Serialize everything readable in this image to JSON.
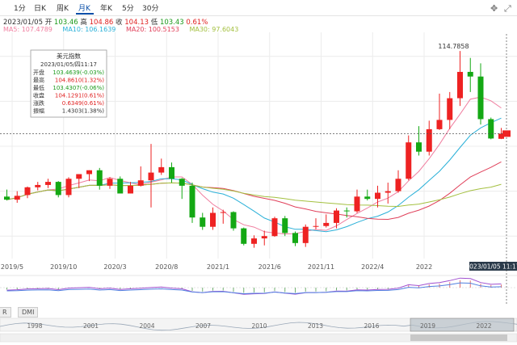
{
  "tabs": [
    {
      "label": "1分",
      "active": false
    },
    {
      "label": "日K",
      "active": false
    },
    {
      "label": "周K",
      "active": false
    },
    {
      "label": "月K",
      "active": true
    },
    {
      "label": "年K",
      "active": false
    },
    {
      "label": "5分",
      "active": false
    },
    {
      "label": "30分",
      "active": false
    }
  ],
  "icons": [
    "move-icon",
    "fullscreen-icon"
  ],
  "info": {
    "date": "2023/01/05",
    "open_label": "开",
    "open": "103.46",
    "high_label": "高",
    "high": "104.86",
    "close_label": "收",
    "close": "104.13",
    "low_label": "低",
    "low": "103.43",
    "change": "0.61%"
  },
  "ma": [
    {
      "label": "MA5: 107.4789",
      "color": "#f07fa0"
    },
    {
      "label": "MA10: 106.1639",
      "color": "#2ab0d8"
    },
    {
      "label": "MA20: 100.5153",
      "color": "#e0405a"
    },
    {
      "label": "MA30: 97.6043",
      "color": "#a4c040"
    }
  ],
  "tooltip": {
    "title": "美元指数",
    "date": "2023/01/05/四11:17",
    "rows": [
      {
        "label": "开盘",
        "value": "103.4639(-0.03%)",
        "color": "#1a9a1a"
      },
      {
        "label": "最高",
        "value": "104.8610(1.32%)",
        "color": "#e02020"
      },
      {
        "label": "最低",
        "value": "103.4307(-0.06%)",
        "color": "#1a9a1a"
      },
      {
        "label": "收盘",
        "value": "104.1291(0.61%)",
        "color": "#e02020"
      },
      {
        "label": "涨跌",
        "value": "0.6349(0.61%)",
        "color": "#e02020"
      },
      {
        "label": "振幅",
        "value": "1.4303(1.38%)",
        "color": "#333333"
      }
    ]
  },
  "peak_label": "114.7858",
  "current_time_label": "2023/01/05 11:17",
  "colors": {
    "up": "#ee2222",
    "down": "#14a814",
    "accent": "#0a4fa8"
  },
  "bottom_tabs": [
    "R",
    "DMI"
  ],
  "chart_data": {
    "type": "candlestick",
    "title": "美元指数",
    "ylim": [
      88,
      117
    ],
    "x_tick_labels": [
      "2019/5",
      "2019/10",
      "2020/3",
      "2020/8",
      "2021/1",
      "2021/6",
      "2021/11",
      "2022/4",
      "2022"
    ],
    "x_tick_index": [
      0,
      5,
      10,
      15,
      20,
      25,
      30,
      35,
      40
    ],
    "candles": [
      {
        "date": "2019/01",
        "o": 96.0,
        "h": 96.9,
        "l": 95.5,
        "c": 95.6
      },
      {
        "date": "2019/02",
        "o": 95.6,
        "h": 96.7,
        "l": 95.2,
        "c": 96.1
      },
      {
        "date": "2019/03",
        "o": 96.2,
        "h": 97.3,
        "l": 95.8,
        "c": 97.2
      },
      {
        "date": "2019/04",
        "o": 97.2,
        "h": 97.9,
        "l": 96.8,
        "c": 97.5
      },
      {
        "date": "2019/05",
        "o": 97.5,
        "h": 98.3,
        "l": 97.1,
        "c": 97.9
      },
      {
        "date": "2019/06",
        "o": 97.9,
        "h": 98.0,
        "l": 95.9,
        "c": 96.2
      },
      {
        "date": "2019/07",
        "o": 96.2,
        "h": 98.5,
        "l": 95.9,
        "c": 98.3
      },
      {
        "date": "2019/08",
        "o": 98.3,
        "h": 98.9,
        "l": 97.1,
        "c": 98.9
      },
      {
        "date": "2019/09",
        "o": 98.9,
        "h": 99.4,
        "l": 98.0,
        "c": 99.4
      },
      {
        "date": "2019/10",
        "o": 99.4,
        "h": 99.7,
        "l": 96.9,
        "c": 97.4
      },
      {
        "date": "2019/11",
        "o": 97.4,
        "h": 98.5,
        "l": 97.0,
        "c": 98.3
      },
      {
        "date": "2019/12",
        "o": 98.3,
        "h": 98.6,
        "l": 96.6,
        "c": 96.4
      },
      {
        "date": "2020/01",
        "o": 96.4,
        "h": 97.9,
        "l": 96.4,
        "c": 97.4
      },
      {
        "date": "2020/02",
        "o": 97.4,
        "h": 99.9,
        "l": 97.3,
        "c": 98.1
      },
      {
        "date": "2020/03",
        "o": 98.1,
        "h": 102.8,
        "l": 94.6,
        "c": 99.1
      },
      {
        "date": "2020/04",
        "o": 99.1,
        "h": 100.9,
        "l": 98.8,
        "c": 99.8
      },
      {
        "date": "2020/05",
        "o": 99.8,
        "h": 100.4,
        "l": 97.8,
        "c": 98.3
      },
      {
        "date": "2020/06",
        "o": 98.3,
        "h": 98.4,
        "l": 95.7,
        "c": 97.4
      },
      {
        "date": "2020/07",
        "o": 97.4,
        "h": 97.8,
        "l": 92.6,
        "c": 93.3
      },
      {
        "date": "2020/08",
        "o": 93.3,
        "h": 93.9,
        "l": 91.7,
        "c": 92.1
      },
      {
        "date": "2020/09",
        "o": 92.1,
        "h": 94.6,
        "l": 91.7,
        "c": 93.9
      },
      {
        "date": "2020/10",
        "o": 93.9,
        "h": 94.3,
        "l": 92.5,
        "c": 94.0
      },
      {
        "date": "2020/11",
        "o": 94.0,
        "h": 94.1,
        "l": 91.6,
        "c": 91.9
      },
      {
        "date": "2020/12",
        "o": 91.9,
        "h": 92.0,
        "l": 89.7,
        "c": 89.9
      },
      {
        "date": "2021/01",
        "o": 89.9,
        "h": 91.0,
        "l": 89.4,
        "c": 90.6
      },
      {
        "date": "2021/02",
        "o": 90.6,
        "h": 91.6,
        "l": 89.7,
        "c": 90.9
      },
      {
        "date": "2021/03",
        "o": 90.9,
        "h": 93.4,
        "l": 90.8,
        "c": 93.2
      },
      {
        "date": "2021/04",
        "o": 93.2,
        "h": 93.5,
        "l": 90.9,
        "c": 91.3
      },
      {
        "date": "2021/05",
        "o": 91.3,
        "h": 91.5,
        "l": 89.6,
        "c": 90.0
      },
      {
        "date": "2021/06",
        "o": 90.0,
        "h": 92.4,
        "l": 89.5,
        "c": 92.1
      },
      {
        "date": "2021/07",
        "o": 92.1,
        "h": 93.2,
        "l": 91.8,
        "c": 92.2
      },
      {
        "date": "2021/08",
        "o": 92.2,
        "h": 93.7,
        "l": 92.0,
        "c": 92.6
      },
      {
        "date": "2021/09",
        "o": 92.6,
        "h": 94.5,
        "l": 91.9,
        "c": 94.2
      },
      {
        "date": "2021/10",
        "o": 94.2,
        "h": 94.6,
        "l": 93.3,
        "c": 94.1
      },
      {
        "date": "2021/11",
        "o": 94.1,
        "h": 96.9,
        "l": 93.9,
        "c": 96.0
      },
      {
        "date": "2021/12",
        "o": 96.0,
        "h": 96.9,
        "l": 95.5,
        "c": 95.7
      },
      {
        "date": "2022/01",
        "o": 95.7,
        "h": 97.4,
        "l": 94.6,
        "c": 96.5
      },
      {
        "date": "2022/02",
        "o": 96.5,
        "h": 97.8,
        "l": 95.1,
        "c": 96.7
      },
      {
        "date": "2022/03",
        "o": 96.7,
        "h": 99.4,
        "l": 96.5,
        "c": 98.3
      },
      {
        "date": "2022/04",
        "o": 98.3,
        "h": 103.9,
        "l": 98.1,
        "c": 103.0
      },
      {
        "date": "2022/05",
        "o": 103.0,
        "h": 105.1,
        "l": 101.3,
        "c": 101.8
      },
      {
        "date": "2022/06",
        "o": 101.8,
        "h": 105.8,
        "l": 101.3,
        "c": 104.7
      },
      {
        "date": "2022/07",
        "o": 104.7,
        "h": 109.3,
        "l": 104.6,
        "c": 105.9
      },
      {
        "date": "2022/08",
        "o": 105.9,
        "h": 109.5,
        "l": 104.7,
        "c": 108.7
      },
      {
        "date": "2022/09",
        "o": 108.7,
        "h": 114.8,
        "l": 107.7,
        "c": 112.1
      },
      {
        "date": "2022/10",
        "o": 112.1,
        "h": 113.9,
        "l": 109.5,
        "c": 111.5
      },
      {
        "date": "2022/11",
        "o": 111.5,
        "h": 113.2,
        "l": 105.3,
        "c": 106.0
      },
      {
        "date": "2022/12",
        "o": 106.0,
        "h": 106.2,
        "l": 103.4,
        "c": 103.5
      },
      {
        "date": "2023/01",
        "o": 103.46,
        "h": 104.86,
        "l": 103.43,
        "c": 104.13
      }
    ]
  }
}
